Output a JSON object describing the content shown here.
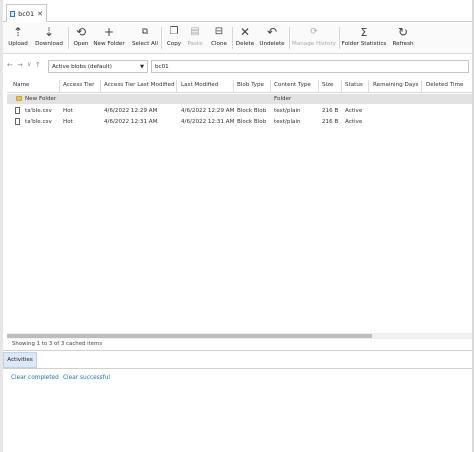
{
  "tab": {
    "title": "bc01",
    "close": "✕"
  },
  "toolbar": {
    "upload": "Upload",
    "download": "Download",
    "open": "Open",
    "new_folder": "New Folder",
    "select_all": "Select All",
    "copy": "Copy",
    "paste": "Paste",
    "clone": "Clone",
    "delete": "Delete",
    "undelete": "Undelete",
    "manage_history": "Manage History",
    "folder_statistics": "Folder Statistics",
    "refresh": "Refresh"
  },
  "nav": {
    "back": "←",
    "forward": "→",
    "recent": "∨",
    "up": "↑",
    "view_selected": "Active blobs (default)",
    "path": "bc01"
  },
  "columns": [
    "Name",
    "Access Tier",
    "Access Tier Last Modified",
    "Last Modified",
    "Blob Type",
    "Content Type",
    "Size",
    "Status",
    "Remaining Days",
    "Deleted Time"
  ],
  "rows": [
    {
      "name": "New Folder",
      "tier": "",
      "tier_modified": "",
      "last_modified": "",
      "blob_type": "",
      "content_type": "Folder",
      "size": "",
      "status": "",
      "kind": "folder"
    },
    {
      "name": "ta'ble.csv",
      "tier": "Hot",
      "tier_modified": "4/6/2022 12:29 AM",
      "last_modified": "4/6/2022 12:29 AM",
      "blob_type": "Block Blob",
      "content_type": "text/plain",
      "size": "216 B",
      "status": "Active",
      "kind": "file"
    },
    {
      "name": "ta'ble.csv",
      "tier": "Hot",
      "tier_modified": "4/6/2022 12:31 AM",
      "last_modified": "4/6/2022 12:31 AM",
      "blob_type": "Block Blob",
      "content_type": "text/plain",
      "size": "216 B",
      "status": "Active",
      "kind": "file"
    }
  ],
  "status_text": "Showing 1 to 3 of 3 cached items",
  "activities": {
    "tab_label": "Activities",
    "clear_completed": "Clear completed",
    "clear_successful": "Clear successful"
  }
}
